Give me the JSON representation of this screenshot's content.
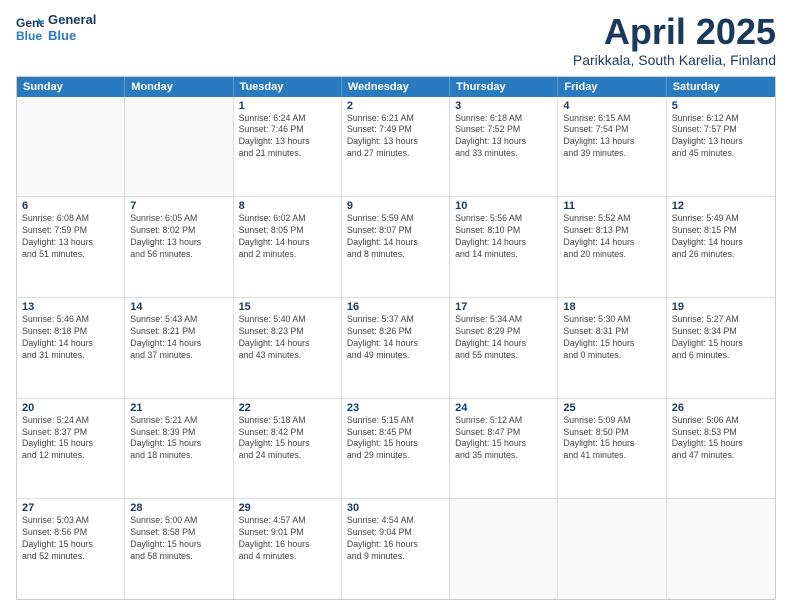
{
  "logo": {
    "line1": "General",
    "line2": "Blue"
  },
  "title": "April 2025",
  "subtitle": "Parikkala, South Karelia, Finland",
  "header_days": [
    "Sunday",
    "Monday",
    "Tuesday",
    "Wednesday",
    "Thursday",
    "Friday",
    "Saturday"
  ],
  "rows": [
    [
      {
        "day": "",
        "text": "",
        "empty": true
      },
      {
        "day": "",
        "text": "",
        "empty": true
      },
      {
        "day": "1",
        "text": "Sunrise: 6:24 AM\nSunset: 7:46 PM\nDaylight: 13 hours\nand 21 minutes."
      },
      {
        "day": "2",
        "text": "Sunrise: 6:21 AM\nSunset: 7:49 PM\nDaylight: 13 hours\nand 27 minutes."
      },
      {
        "day": "3",
        "text": "Sunrise: 6:18 AM\nSunset: 7:52 PM\nDaylight: 13 hours\nand 33 minutes."
      },
      {
        "day": "4",
        "text": "Sunrise: 6:15 AM\nSunset: 7:54 PM\nDaylight: 13 hours\nand 39 minutes."
      },
      {
        "day": "5",
        "text": "Sunrise: 6:12 AM\nSunset: 7:57 PM\nDaylight: 13 hours\nand 45 minutes."
      }
    ],
    [
      {
        "day": "6",
        "text": "Sunrise: 6:08 AM\nSunset: 7:59 PM\nDaylight: 13 hours\nand 51 minutes."
      },
      {
        "day": "7",
        "text": "Sunrise: 6:05 AM\nSunset: 8:02 PM\nDaylight: 13 hours\nand 56 minutes."
      },
      {
        "day": "8",
        "text": "Sunrise: 6:02 AM\nSunset: 8:05 PM\nDaylight: 14 hours\nand 2 minutes."
      },
      {
        "day": "9",
        "text": "Sunrise: 5:59 AM\nSunset: 8:07 PM\nDaylight: 14 hours\nand 8 minutes."
      },
      {
        "day": "10",
        "text": "Sunrise: 5:56 AM\nSunset: 8:10 PM\nDaylight: 14 hours\nand 14 minutes."
      },
      {
        "day": "11",
        "text": "Sunrise: 5:52 AM\nSunset: 8:13 PM\nDaylight: 14 hours\nand 20 minutes."
      },
      {
        "day": "12",
        "text": "Sunrise: 5:49 AM\nSunset: 8:15 PM\nDaylight: 14 hours\nand 26 minutes."
      }
    ],
    [
      {
        "day": "13",
        "text": "Sunrise: 5:46 AM\nSunset: 8:18 PM\nDaylight: 14 hours\nand 31 minutes."
      },
      {
        "day": "14",
        "text": "Sunrise: 5:43 AM\nSunset: 8:21 PM\nDaylight: 14 hours\nand 37 minutes."
      },
      {
        "day": "15",
        "text": "Sunrise: 5:40 AM\nSunset: 8:23 PM\nDaylight: 14 hours\nand 43 minutes."
      },
      {
        "day": "16",
        "text": "Sunrise: 5:37 AM\nSunset: 8:26 PM\nDaylight: 14 hours\nand 49 minutes."
      },
      {
        "day": "17",
        "text": "Sunrise: 5:34 AM\nSunset: 8:29 PM\nDaylight: 14 hours\nand 55 minutes."
      },
      {
        "day": "18",
        "text": "Sunrise: 5:30 AM\nSunset: 8:31 PM\nDaylight: 15 hours\nand 0 minutes."
      },
      {
        "day": "19",
        "text": "Sunrise: 5:27 AM\nSunset: 8:34 PM\nDaylight: 15 hours\nand 6 minutes."
      }
    ],
    [
      {
        "day": "20",
        "text": "Sunrise: 5:24 AM\nSunset: 8:37 PM\nDaylight: 15 hours\nand 12 minutes."
      },
      {
        "day": "21",
        "text": "Sunrise: 5:21 AM\nSunset: 8:39 PM\nDaylight: 15 hours\nand 18 minutes."
      },
      {
        "day": "22",
        "text": "Sunrise: 5:18 AM\nSunset: 8:42 PM\nDaylight: 15 hours\nand 24 minutes."
      },
      {
        "day": "23",
        "text": "Sunrise: 5:15 AM\nSunset: 8:45 PM\nDaylight: 15 hours\nand 29 minutes."
      },
      {
        "day": "24",
        "text": "Sunrise: 5:12 AM\nSunset: 8:47 PM\nDaylight: 15 hours\nand 35 minutes."
      },
      {
        "day": "25",
        "text": "Sunrise: 5:09 AM\nSunset: 8:50 PM\nDaylight: 15 hours\nand 41 minutes."
      },
      {
        "day": "26",
        "text": "Sunrise: 5:06 AM\nSunset: 8:53 PM\nDaylight: 15 hours\nand 47 minutes."
      }
    ],
    [
      {
        "day": "27",
        "text": "Sunrise: 5:03 AM\nSunset: 8:56 PM\nDaylight: 15 hours\nand 52 minutes."
      },
      {
        "day": "28",
        "text": "Sunrise: 5:00 AM\nSunset: 8:58 PM\nDaylight: 15 hours\nand 58 minutes."
      },
      {
        "day": "29",
        "text": "Sunrise: 4:57 AM\nSunset: 9:01 PM\nDaylight: 16 hours\nand 4 minutes."
      },
      {
        "day": "30",
        "text": "Sunrise: 4:54 AM\nSunset: 9:04 PM\nDaylight: 16 hours\nand 9 minutes."
      },
      {
        "day": "",
        "text": "",
        "empty": true
      },
      {
        "day": "",
        "text": "",
        "empty": true
      },
      {
        "day": "",
        "text": "",
        "empty": true
      }
    ]
  ]
}
